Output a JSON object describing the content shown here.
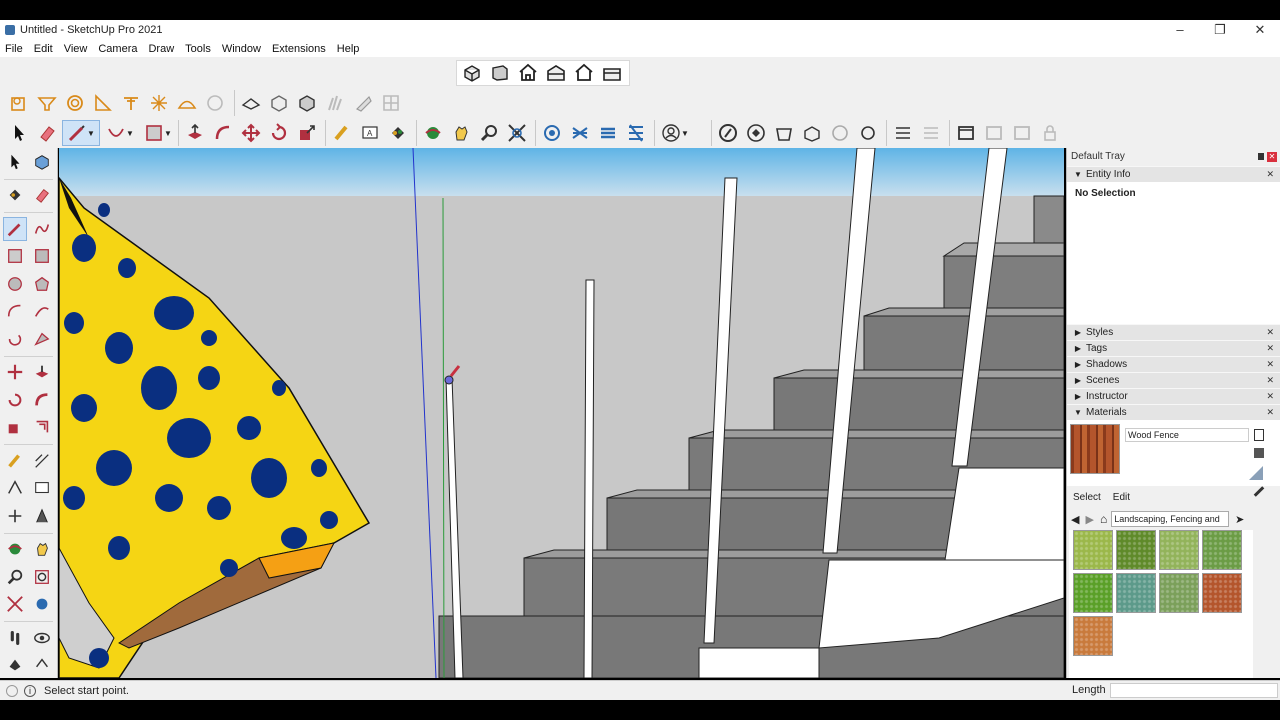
{
  "window": {
    "title": "Untitled - SketchUp Pro 2021",
    "controls": [
      "minimize-icon",
      "restore-icon",
      "close-icon"
    ]
  },
  "menu": [
    "File",
    "Edit",
    "View",
    "Camera",
    "Draw",
    "Tools",
    "Window",
    "Extensions",
    "Help"
  ],
  "toolbar": {
    "views": [
      "iso-view-icon",
      "top-view-icon",
      "front-view-icon",
      "right-view-icon",
      "back-view-icon",
      "left-view-icon"
    ],
    "row2": [
      "styles-icon",
      "xray-icon",
      "wireframe-icon",
      "hidden-line-icon",
      "shaded-icon",
      "shaded-textures-icon",
      "monochrome-icon",
      "component-icon",
      "model-info-icon",
      "sandbox-icon",
      "terrain-icon",
      "dynamic-icon"
    ],
    "row3": [
      "select-icon",
      "eraser-icon",
      "line-icon",
      "arc-icon",
      "rectangle-icon",
      "pushpull-icon",
      "follow-me-icon",
      "move-icon",
      "rotate-icon",
      "scale-icon",
      "tape-measure-icon",
      "text-icon",
      "paint-bucket-icon",
      "orbit-icon",
      "pan-icon",
      "zoom-icon",
      "zoom-extents-icon",
      "section-plane-icon",
      "section-cut-icon",
      "section-fill-icon",
      "user-icon",
      "extension-warehouse-icon",
      "3d-warehouse-icon",
      "layout-icon",
      "components-icon",
      "solid-tools-icon"
    ]
  },
  "lefttools": [
    "select-icon",
    "make-component-icon",
    "paint-bucket-icon",
    "eraser-icon",
    "line-icon",
    "freehand-icon",
    "rectangle-icon",
    "rotated-rectangle-icon",
    "circle-icon",
    "polygon-icon",
    "arc-icon",
    "2pt-arc-icon",
    "3pt-arc-icon",
    "pie-icon",
    "move-icon",
    "pushpull-icon",
    "rotate-icon",
    "follow-me-icon",
    "scale-icon",
    "offset-icon",
    "tape-measure-icon",
    "dimension-icon",
    "protractor-icon",
    "text-icon",
    "axes-icon",
    "3d-text-icon",
    "orbit-icon",
    "pan-icon",
    "zoom-icon",
    "zoom-window-icon",
    "zoom-extents-icon",
    "previous-view-icon",
    "walk-icon",
    "look-around-icon",
    "position-camera-icon",
    "section-plane-icon"
  ],
  "tray": {
    "title": "Default Tray",
    "entity_info": {
      "label": "Entity Info",
      "selection": "No Selection"
    },
    "panels": [
      "Styles",
      "Tags",
      "Shadows",
      "Scenes",
      "Instructor",
      "Materials"
    ],
    "materials": {
      "current_name": "Wood Fence",
      "tab_select": "Select",
      "tab_edit": "Edit",
      "collection": "Landscaping, Fencing and",
      "swatches": [
        "#9bb84a",
        "#5f8a2a",
        "#92b35a",
        "#6b9c45",
        "#5aa028",
        "#5c9a8a",
        "#7ba05a",
        "#b4552c",
        "#c97a3c"
      ]
    }
  },
  "status": {
    "message": "Select start point.",
    "length_label": "Length",
    "length_value": ""
  },
  "colors": {
    "sky": "#5fb4e6",
    "ground": "#c8c8c8",
    "accent_red": "#d9303e"
  }
}
